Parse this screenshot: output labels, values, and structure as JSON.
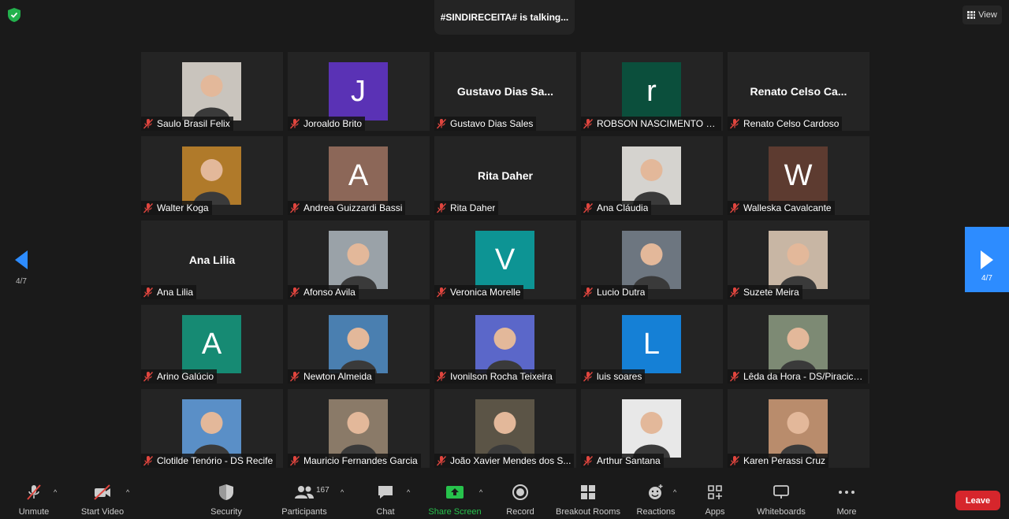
{
  "topbar": {
    "talking_text": "#SINDIRECEITA# is talking...",
    "view_label": "View"
  },
  "pager": {
    "current": "4/7"
  },
  "participants": [
    {
      "name": "Saulo Brasil Felix",
      "type": "photo",
      "photo_color": "#c9c4bd"
    },
    {
      "name": "Joroaldo Brito",
      "type": "letter",
      "letter": "J",
      "color": "#5a32b5"
    },
    {
      "name": "Gustavo Dias Sales",
      "type": "text",
      "display": "Gustavo Dias Sa..."
    },
    {
      "name": "ROBSON NASCIMENTO M...",
      "type": "letter",
      "letter": "r",
      "color": "#0b4f3c"
    },
    {
      "name": "Renato Celso Cardoso",
      "type": "text",
      "display": "Renato Celso Ca..."
    },
    {
      "name": "Walter Koga",
      "type": "photo",
      "photo_color": "#b07a2a"
    },
    {
      "name": "Andrea Guizzardi Bassi",
      "type": "letter",
      "letter": "A",
      "color": "#8c6758"
    },
    {
      "name": "Rita Daher",
      "type": "text",
      "display": "Rita Daher"
    },
    {
      "name": "Ana Cláudia",
      "type": "photo",
      "photo_color": "#d5d3cf"
    },
    {
      "name": "Walleska Cavalcante",
      "type": "letter",
      "letter": "W",
      "color": "#5d3b30"
    },
    {
      "name": "Ana Lilia",
      "type": "text",
      "display": "Ana Lilia"
    },
    {
      "name": "Afonso Avila",
      "type": "photo",
      "photo_color": "#9aa2a8"
    },
    {
      "name": "Veronica Morelle",
      "type": "letter",
      "letter": "V",
      "color": "#0d9494"
    },
    {
      "name": "Lucio Dutra",
      "type": "photo",
      "photo_color": "#6d7680"
    },
    {
      "name": "Suzete Meira",
      "type": "photo",
      "photo_color": "#c8b6a4"
    },
    {
      "name": "Arino Galúcio",
      "type": "letter",
      "letter": "A",
      "color": "#168a73"
    },
    {
      "name": "Newton Almeida",
      "type": "photo",
      "photo_color": "#4a7fb0"
    },
    {
      "name": "Ivonilson Rocha Teixeira",
      "type": "photo",
      "photo_color": "#5b67c9"
    },
    {
      "name": "luis soares",
      "type": "letter",
      "letter": "L",
      "color": "#1580d6"
    },
    {
      "name": "Lêda da Hora - DS/Piracica...",
      "type": "photo",
      "photo_color": "#7d8a74"
    },
    {
      "name": "Clotilde Tenório - DS Recife",
      "type": "photo",
      "photo_color": "#5a8fc7"
    },
    {
      "name": "Mauricio Fernandes Garcia",
      "type": "photo",
      "photo_color": "#8a7a68"
    },
    {
      "name": "João Xavier Mendes dos S...",
      "type": "photo",
      "photo_color": "#5b5446"
    },
    {
      "name": "Arthur Santana",
      "type": "photo",
      "photo_color": "#e8e8e8"
    },
    {
      "name": "Karen Perassi Cruz",
      "type": "photo",
      "photo_color": "#b98c6c"
    }
  ],
  "toolbar": {
    "unmute": "Unmute",
    "start_video": "Start Video",
    "security": "Security",
    "participants": "Participants",
    "participant_count": "167",
    "chat": "Chat",
    "share_screen": "Share Screen",
    "record": "Record",
    "breakout_rooms": "Breakout Rooms",
    "reactions": "Reactions",
    "apps": "Apps",
    "whiteboards": "Whiteboards",
    "more": "More",
    "leave": "Leave"
  },
  "colors": {
    "accent": "#2d8cff",
    "share_green": "#27c24c",
    "leave_red": "#d6262c",
    "muted_red": "#e0453e"
  }
}
